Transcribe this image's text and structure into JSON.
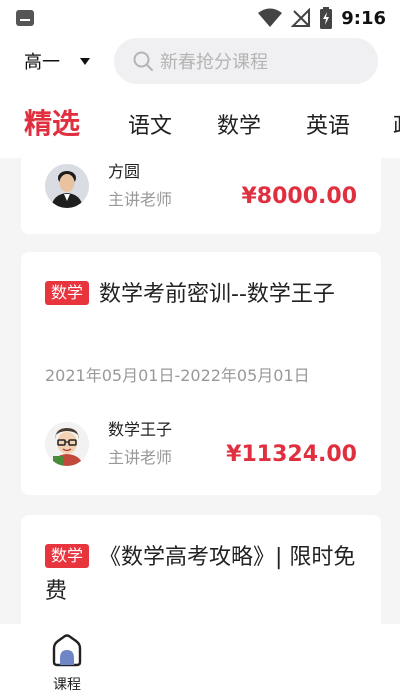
{
  "status_bar": {
    "time": "9:16"
  },
  "header": {
    "grade": "高一",
    "search_placeholder": "新春抢分课程"
  },
  "tabs": [
    {
      "label": "精选",
      "active": true
    },
    {
      "label": "语文",
      "active": false
    },
    {
      "label": "数学",
      "active": false
    },
    {
      "label": "英语",
      "active": false
    },
    {
      "label": "政",
      "active": false
    }
  ],
  "courses": [
    {
      "teacher": {
        "name": "方圆",
        "role": "主讲老师"
      },
      "price": "¥8000.00"
    },
    {
      "badge": "数学",
      "title": "数学考前密训--数学王子",
      "date_range": "2021年05月01日-2022年05月01日",
      "teacher": {
        "name": "数学王子",
        "role": "主讲老师"
      },
      "price": "¥11324.00"
    },
    {
      "badge": "数学",
      "title": "《数学高考攻略》| 限时免费"
    }
  ],
  "bottom_nav": {
    "course_label": "课程"
  },
  "colors": {
    "accent": "#e0303f",
    "badge": "#e8353d"
  }
}
